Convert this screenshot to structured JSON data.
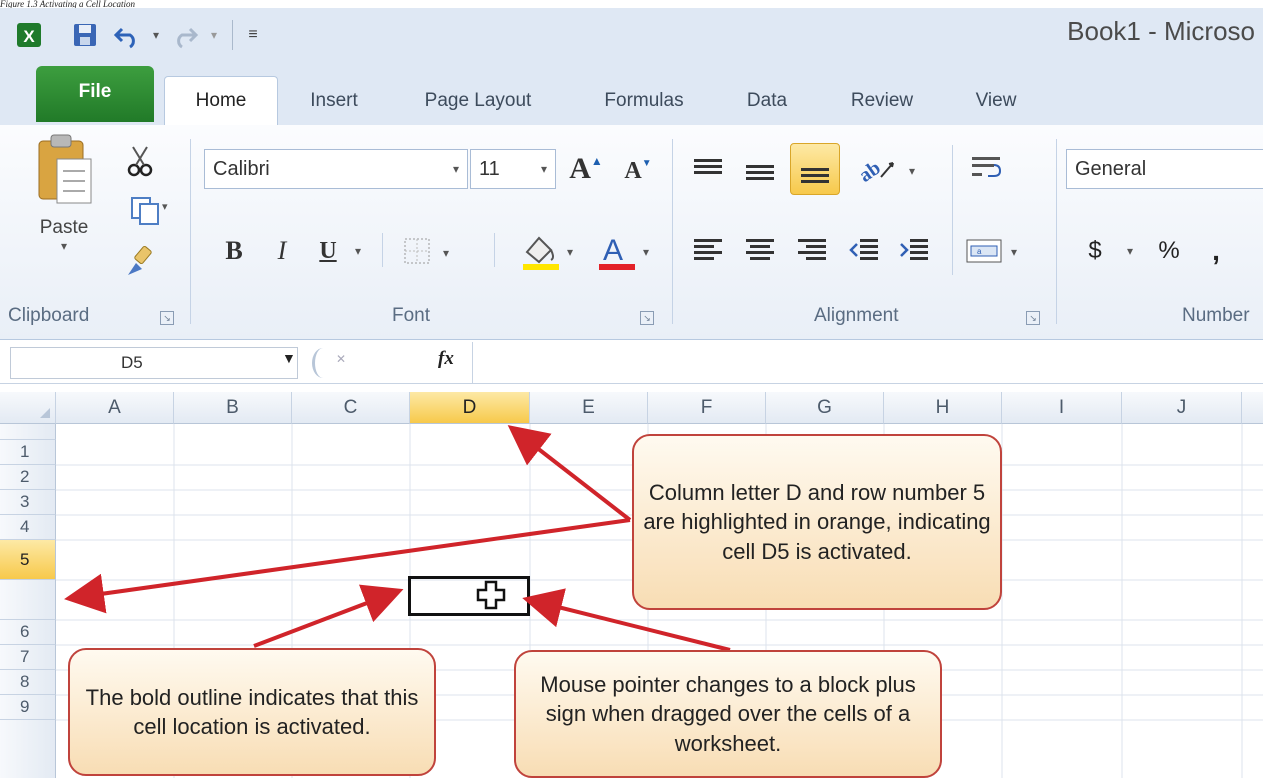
{
  "caption": "Figure 1.3 Activating a Cell Location",
  "window": {
    "title": "Book1 - Microso"
  },
  "qat": {
    "icons": [
      "excel-icon",
      "save-icon",
      "undo-icon",
      "redo-icon",
      "customize-qat-icon"
    ]
  },
  "tabs": [
    "File",
    "Home",
    "Insert",
    "Page Layout",
    "Formulas",
    "Data",
    "Review",
    "View"
  ],
  "ribbon": {
    "clipboard": {
      "paste_label": "Paste",
      "group_label": "Clipboard"
    },
    "font": {
      "font_name": "Calibri",
      "font_size": "11",
      "group_label": "Font",
      "bold": "B",
      "italic": "I",
      "underline": "U",
      "font_color_letter": "A",
      "grow": "A",
      "shrink": "A"
    },
    "alignment": {
      "group_label": "Alignment"
    },
    "number": {
      "format": "General",
      "group_label": "Number",
      "currency": "$",
      "percent": "%",
      "comma": ","
    }
  },
  "formula_bar": {
    "name_box": "D5",
    "fx": "fx",
    "formula": ""
  },
  "grid": {
    "columns": [
      "A",
      "B",
      "C",
      "D",
      "E",
      "F",
      "G",
      "H",
      "I",
      "J"
    ],
    "rows": [
      "1",
      "2",
      "3",
      "4",
      "5",
      "6",
      "7",
      "8",
      "9"
    ],
    "active_column": "D",
    "active_row": "5",
    "active_cell": "D5"
  },
  "callouts": {
    "top": "Column letter D and row number 5 are highlighted in orange, indicating cell D5 is activated.",
    "left": "The bold outline indicates that this cell location is activated.",
    "right": "Mouse pointer changes to a block plus sign when dragged over the cells of a worksheet."
  },
  "colors": {
    "accent": "#f7c94b",
    "callout_border": "#c0433c",
    "arrow": "#d0242a",
    "file_tab": "#2a8a30"
  }
}
